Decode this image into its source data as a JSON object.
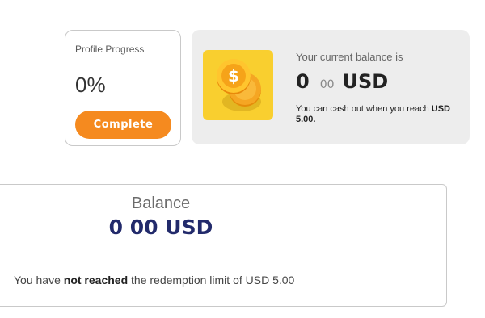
{
  "profile": {
    "title": "Profile Progress",
    "percent": "0%",
    "button_label": "Complete"
  },
  "current_balance": {
    "label": "Your current balance is",
    "whole": "0",
    "cents": "00",
    "currency": "USD",
    "note_prefix": "You can cash out when you reach",
    "note_threshold": "USD 5.00."
  },
  "summary": {
    "title": "Balance",
    "amount": "0 00 USD",
    "note_prefix": "You have",
    "note_emphasis": "not reached",
    "note_suffix": "the redemption limit of USD 5.00"
  },
  "colors": {
    "accent_orange": "#f58a1f",
    "coin_tile": "#f9cf2f",
    "amount_navy": "#222a6b"
  },
  "icons": {
    "coin": "dollar-coins-icon"
  }
}
